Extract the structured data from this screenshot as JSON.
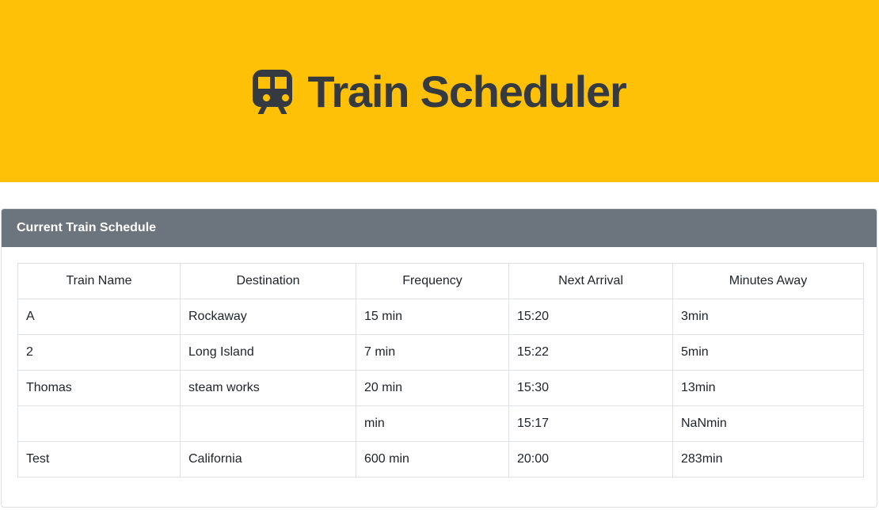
{
  "header": {
    "title": "Train Scheduler",
    "icon": "train-icon",
    "background_color": "#ffc107",
    "title_color": "#343a40"
  },
  "schedule": {
    "heading": "Current Train Schedule",
    "header_color": "#6c757d",
    "columns": [
      "Train Name",
      "Destination",
      "Frequency",
      "Next Arrival",
      "Minutes Away"
    ],
    "rows": [
      [
        "A",
        "Rockaway",
        "15 min",
        "15:20",
        "3min"
      ],
      [
        "2",
        "Long Island",
        "7 min",
        "15:22",
        "5min"
      ],
      [
        "Thomas",
        "steam works",
        "20 min",
        "15:30",
        "13min"
      ],
      [
        "",
        "",
        "min",
        "15:17",
        "NaNmin"
      ],
      [
        "Test",
        "California",
        "600 min",
        "20:00",
        "283min"
      ]
    ]
  }
}
